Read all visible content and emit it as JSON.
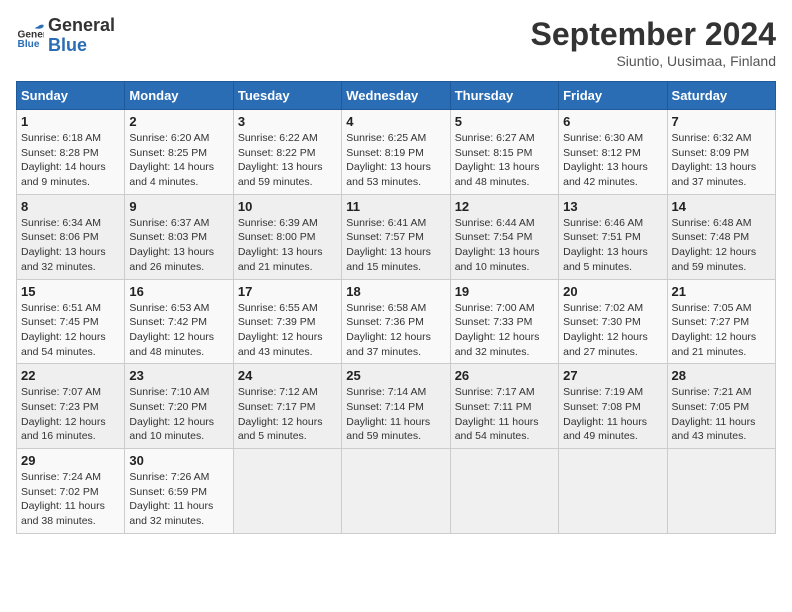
{
  "header": {
    "logo_general": "General",
    "logo_blue": "Blue",
    "month_title": "September 2024",
    "location": "Siuntio, Uusimaa, Finland"
  },
  "days_of_week": [
    "Sunday",
    "Monday",
    "Tuesday",
    "Wednesday",
    "Thursday",
    "Friday",
    "Saturday"
  ],
  "weeks": [
    [
      {
        "day": "1",
        "sunrise": "6:18 AM",
        "sunset": "8:28 PM",
        "daylight": "14 hours and 9 minutes."
      },
      {
        "day": "2",
        "sunrise": "6:20 AM",
        "sunset": "8:25 PM",
        "daylight": "14 hours and 4 minutes."
      },
      {
        "day": "3",
        "sunrise": "6:22 AM",
        "sunset": "8:22 PM",
        "daylight": "13 hours and 59 minutes."
      },
      {
        "day": "4",
        "sunrise": "6:25 AM",
        "sunset": "8:19 PM",
        "daylight": "13 hours and 53 minutes."
      },
      {
        "day": "5",
        "sunrise": "6:27 AM",
        "sunset": "8:15 PM",
        "daylight": "13 hours and 48 minutes."
      },
      {
        "day": "6",
        "sunrise": "6:30 AM",
        "sunset": "8:12 PM",
        "daylight": "13 hours and 42 minutes."
      },
      {
        "day": "7",
        "sunrise": "6:32 AM",
        "sunset": "8:09 PM",
        "daylight": "13 hours and 37 minutes."
      }
    ],
    [
      {
        "day": "8",
        "sunrise": "6:34 AM",
        "sunset": "8:06 PM",
        "daylight": "13 hours and 32 minutes."
      },
      {
        "day": "9",
        "sunrise": "6:37 AM",
        "sunset": "8:03 PM",
        "daylight": "13 hours and 26 minutes."
      },
      {
        "day": "10",
        "sunrise": "6:39 AM",
        "sunset": "8:00 PM",
        "daylight": "13 hours and 21 minutes."
      },
      {
        "day": "11",
        "sunrise": "6:41 AM",
        "sunset": "7:57 PM",
        "daylight": "13 hours and 15 minutes."
      },
      {
        "day": "12",
        "sunrise": "6:44 AM",
        "sunset": "7:54 PM",
        "daylight": "13 hours and 10 minutes."
      },
      {
        "day": "13",
        "sunrise": "6:46 AM",
        "sunset": "7:51 PM",
        "daylight": "13 hours and 5 minutes."
      },
      {
        "day": "14",
        "sunrise": "6:48 AM",
        "sunset": "7:48 PM",
        "daylight": "12 hours and 59 minutes."
      }
    ],
    [
      {
        "day": "15",
        "sunrise": "6:51 AM",
        "sunset": "7:45 PM",
        "daylight": "12 hours and 54 minutes."
      },
      {
        "day": "16",
        "sunrise": "6:53 AM",
        "sunset": "7:42 PM",
        "daylight": "12 hours and 48 minutes."
      },
      {
        "day": "17",
        "sunrise": "6:55 AM",
        "sunset": "7:39 PM",
        "daylight": "12 hours and 43 minutes."
      },
      {
        "day": "18",
        "sunrise": "6:58 AM",
        "sunset": "7:36 PM",
        "daylight": "12 hours and 37 minutes."
      },
      {
        "day": "19",
        "sunrise": "7:00 AM",
        "sunset": "7:33 PM",
        "daylight": "12 hours and 32 minutes."
      },
      {
        "day": "20",
        "sunrise": "7:02 AM",
        "sunset": "7:30 PM",
        "daylight": "12 hours and 27 minutes."
      },
      {
        "day": "21",
        "sunrise": "7:05 AM",
        "sunset": "7:27 PM",
        "daylight": "12 hours and 21 minutes."
      }
    ],
    [
      {
        "day": "22",
        "sunrise": "7:07 AM",
        "sunset": "7:23 PM",
        "daylight": "12 hours and 16 minutes."
      },
      {
        "day": "23",
        "sunrise": "7:10 AM",
        "sunset": "7:20 PM",
        "daylight": "12 hours and 10 minutes."
      },
      {
        "day": "24",
        "sunrise": "7:12 AM",
        "sunset": "7:17 PM",
        "daylight": "12 hours and 5 minutes."
      },
      {
        "day": "25",
        "sunrise": "7:14 AM",
        "sunset": "7:14 PM",
        "daylight": "11 hours and 59 minutes."
      },
      {
        "day": "26",
        "sunrise": "7:17 AM",
        "sunset": "7:11 PM",
        "daylight": "11 hours and 54 minutes."
      },
      {
        "day": "27",
        "sunrise": "7:19 AM",
        "sunset": "7:08 PM",
        "daylight": "11 hours and 49 minutes."
      },
      {
        "day": "28",
        "sunrise": "7:21 AM",
        "sunset": "7:05 PM",
        "daylight": "11 hours and 43 minutes."
      }
    ],
    [
      {
        "day": "29",
        "sunrise": "7:24 AM",
        "sunset": "7:02 PM",
        "daylight": "11 hours and 38 minutes."
      },
      {
        "day": "30",
        "sunrise": "7:26 AM",
        "sunset": "6:59 PM",
        "daylight": "11 hours and 32 minutes."
      },
      null,
      null,
      null,
      null,
      null
    ]
  ]
}
